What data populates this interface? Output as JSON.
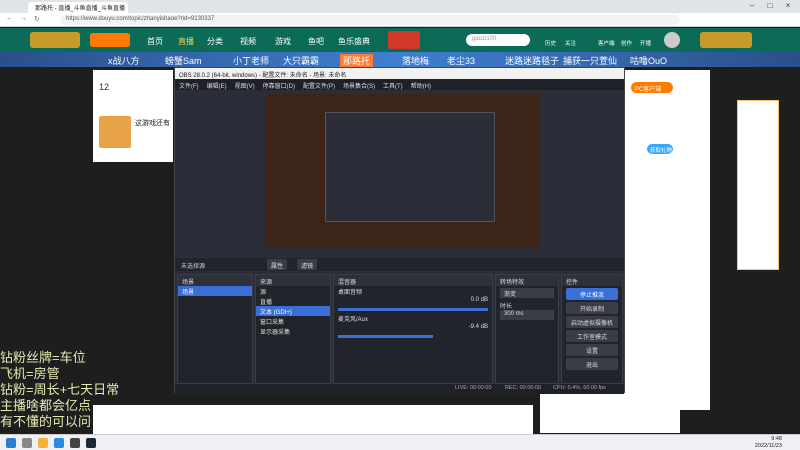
{
  "browser": {
    "tab_title": "那路托 - 直播_斗鱼直播_斗鱼直播",
    "url": "https://www.douyu.com/topic/zhanyishaoe?rid=9130337"
  },
  "douyu_nav": {
    "items": [
      "首页",
      "直播",
      "分类",
      "视频",
      "游戏",
      "鱼吧",
      "鱼乐盛典"
    ],
    "search_placeholder": "gaozi100",
    "right_items": [
      "历史",
      "关注",
      "客户端",
      "创作",
      "开播"
    ]
  },
  "marquee": [
    "x战八方",
    "螃蟹Sam",
    "小丁老师",
    "大只霸霸",
    "那路托",
    "落地梅",
    "老尘33",
    "迷路迷路毯子",
    "捕获一只萱仙",
    "咕噜OuO"
  ],
  "left_panel": {
    "count": "12",
    "title": "这游戏还有"
  },
  "left_text": [
    "钻粉丝牌=车位",
    "飞机=房管",
    "钻粉=周长+七天日常",
    "主播啥都会亿点",
    "有不懂的可以问"
  ],
  "obs": {
    "title": "OBS 28.0.2 (64-bit, windows) - 配置文件: 未命名 - 场景: 未命名",
    "menu": [
      "文件(F)",
      "编辑(E)",
      "视图(V)",
      "停靠窗口(D)",
      "配置文件(P)",
      "场景集合(S)",
      "工具(T)",
      "帮助(H)"
    ],
    "no_source": "未选择源",
    "props_btn": "属性",
    "filters_btn": "滤镜",
    "scenes_title": "场景",
    "scenes": [
      "场景"
    ],
    "sources_title": "来源",
    "sources": [
      "源",
      "直播",
      "文本 (GDI+)",
      "窗口采集",
      "显示器采集"
    ],
    "mixer_title": "混音器",
    "mixer": [
      {
        "name": "桌面音频",
        "db": "0.0 dB"
      },
      {
        "name": "麦克风/Aux",
        "db": "-9.4 dB"
      }
    ],
    "transitions_title": "转场特效",
    "transition": "渐变",
    "duration_label": "时长",
    "duration": "300 ms",
    "controls_title": "控件",
    "controls": [
      "停止推流",
      "开始录制",
      "启动虚拟摄像机",
      "工作室模式",
      "设置",
      "退出"
    ],
    "status": {
      "live": "LIVE: 00:00:00",
      "rec": "REC: 00:00:00",
      "cpu": "CPU: 0.4%, 60.00 fps"
    }
  },
  "right_panel": {
    "badge": "PC客户端",
    "btn": "获取礼物"
  },
  "clock": {
    "time": "9:48",
    "date": "2022/11/23"
  }
}
